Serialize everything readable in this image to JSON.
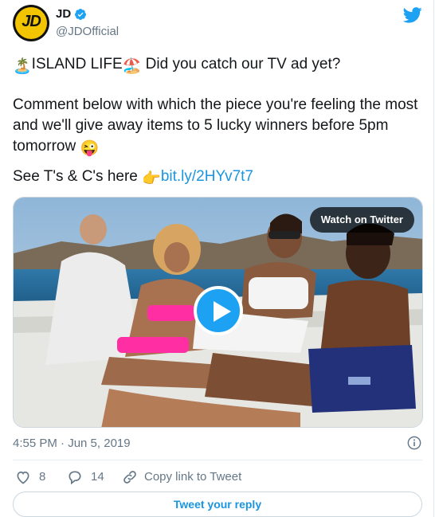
{
  "author": {
    "name": "JD",
    "handle": "@JDOfficial",
    "avatar_text": "JD"
  },
  "tweet": {
    "line1_emoji_a": "🏝️",
    "line1_a": "ISLAND LIFE",
    "line1_emoji_b": "🏖️",
    "line1_b": " Did you catch our TV ad yet?",
    "line2": "Comment below with which the piece you're feeling the most and we'll give away items to 5 lucky winners before 5pm tomorrow ",
    "line2_emoji": "😜",
    "line3": "See T's & C's here ",
    "line3_emoji": "👉",
    "link": "bit.ly/2HYv7t7"
  },
  "media": {
    "watch_label": "Watch on Twitter"
  },
  "timestamp": "4:55 PM · Jun 5, 2019",
  "actions": {
    "likes": "8",
    "replies": "14",
    "copy_link": "Copy link to Tweet"
  },
  "reply_button": "Tweet your reply",
  "colors": {
    "twitter_blue": "#1da1f2",
    "link_blue": "#1b95e0",
    "muted_gray": "#657786"
  },
  "icons": [
    "verified-badge-icon",
    "twitter-bird-icon",
    "play-icon",
    "info-icon",
    "heart-icon",
    "reply-bubble-icon",
    "link-icon"
  ]
}
